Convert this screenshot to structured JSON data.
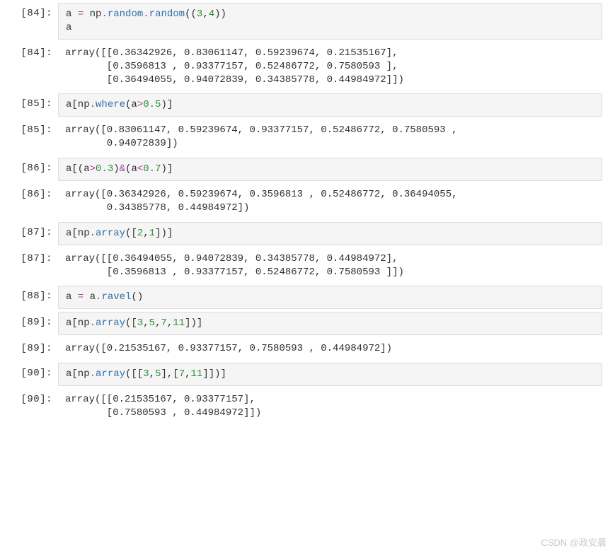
{
  "prompts": {
    "p84a": "[84]:",
    "p84b": "[84]:",
    "p85a": "[85]:",
    "p85b": "[85]:",
    "p86a": "[86]:",
    "p86b": "[86]:",
    "p87a": "[87]:",
    "p87b": "[87]:",
    "p88a": "[88]:",
    "p89a": "[89]:",
    "p89b": "[89]:",
    "p90a": "[90]:",
    "p90b": "[90]:"
  },
  "code": {
    "c84": {
      "a0": "a ",
      "eq": "= ",
      "np0": "np",
      "dot0": ".",
      "rand0": "random",
      "dot1": ".",
      "rand1": "random",
      "lp0": "((",
      "n3": "3",
      "comma0": ",",
      "n4": "4",
      "rp0": "))",
      "line2": "a"
    },
    "c85": {
      "a0": "a[np",
      "dot0": ".",
      "fn0": "where",
      "lp0": "(a",
      "op0": ">",
      "n0": "0.5",
      "rp0": ")]"
    },
    "c86": {
      "a0": "a[(a",
      "op0": ">",
      "n0": "0.3",
      "rp0": ")",
      "amp": "&",
      "lp1": "(a",
      "op1": "<",
      "n1": "0.7",
      "rp1": ")]"
    },
    "c87": {
      "a0": "a[np",
      "dot0": ".",
      "fn0": "array",
      "lp0": "([",
      "n0": "2",
      "c0": ",",
      "n1": "1",
      "rp0": "])]"
    },
    "c88": {
      "a0": "a ",
      "eq": "= ",
      "a1": "a",
      "dot0": ".",
      "fn0": "ravel",
      "pp": "()"
    },
    "c89": {
      "a0": "a[np",
      "dot0": ".",
      "fn0": "array",
      "lp0": "([",
      "n0": "3",
      "c0": ",",
      "n1": "5",
      "c1": ",",
      "n2": "7",
      "c2": ",",
      "n3": "11",
      "rp0": "])]"
    },
    "c90": {
      "a0": "a[np",
      "dot0": ".",
      "fn0": "array",
      "lp0": "([[",
      "n0": "3",
      "c0": ",",
      "n1": "5",
      "rb0": "],[",
      "n2": "7",
      "c1": ",",
      "n3": "11",
      "rp0": "]])]"
    }
  },
  "out": {
    "o84": "array([[0.36342926, 0.83061147, 0.59239674, 0.21535167],\n       [0.3596813 , 0.93377157, 0.52486772, 0.7580593 ],\n       [0.36494055, 0.94072839, 0.34385778, 0.44984972]])",
    "o85": "array([0.83061147, 0.59239674, 0.93377157, 0.52486772, 0.7580593 ,\n       0.94072839])",
    "o86": "array([0.36342926, 0.59239674, 0.3596813 , 0.52486772, 0.36494055,\n       0.34385778, 0.44984972])",
    "o87": "array([[0.36494055, 0.94072839, 0.34385778, 0.44984972],\n       [0.3596813 , 0.93377157, 0.52486772, 0.7580593 ]])",
    "o89": "array([0.21535167, 0.93377157, 0.7580593 , 0.44984972])",
    "o90": "array([[0.21535167, 0.93377157],\n       [0.7580593 , 0.44984972]])"
  },
  "watermark": "CSDN @政安晨"
}
